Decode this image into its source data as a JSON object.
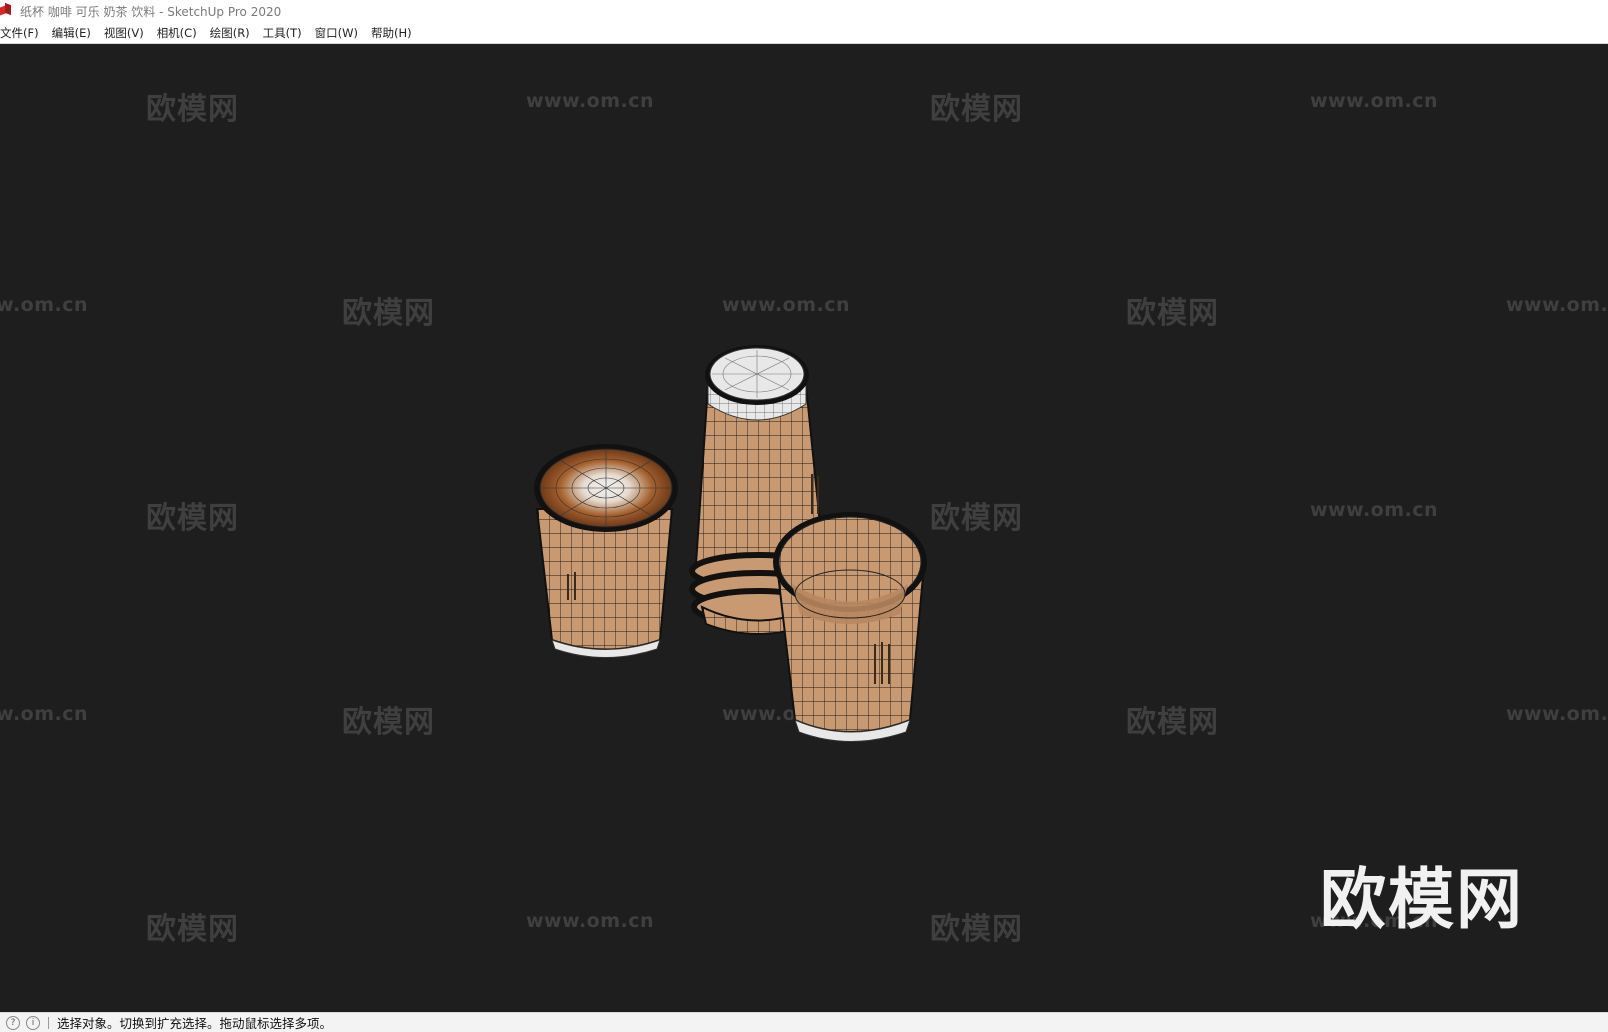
{
  "window": {
    "title": "纸杯 咖啡 可乐 奶茶 饮料 - SketchUp Pro 2020",
    "app_icon": "sketchup-logo-icon"
  },
  "menubar": {
    "items": [
      {
        "label": "文件(F)"
      },
      {
        "label": "编辑(E)"
      },
      {
        "label": "视图(V)"
      },
      {
        "label": "相机(C)"
      },
      {
        "label": "绘图(R)"
      },
      {
        "label": "工具(T)"
      },
      {
        "label": "窗口(W)"
      },
      {
        "label": "帮助(H)"
      }
    ]
  },
  "viewport": {
    "background": "#1e1e1e",
    "model_description": "",
    "watermark_cn": "欧模网",
    "watermark_url": "www.om.cn",
    "logo_text": "欧模网",
    "colors": {
      "cup_paper": "#c99a72",
      "wire": "#1a1a1a",
      "lid_white": "#e8e8e8",
      "coffee": "#8a4a22"
    }
  },
  "statusbar": {
    "icons": [
      "geo-location-icon",
      "info-icon"
    ],
    "message": "选择对象。切换到扩充选择。拖动鼠标选择多项。"
  }
}
